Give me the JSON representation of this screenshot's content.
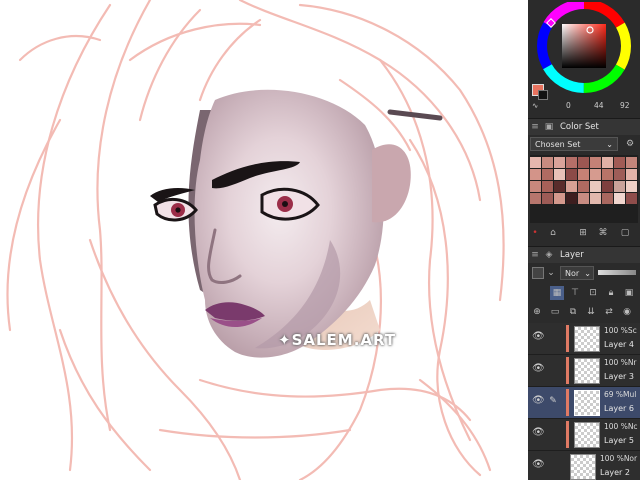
{
  "canvas": {
    "watermark": "✦SALEM.ART"
  },
  "color_wheel": {
    "hue_color": "#ff2a1a",
    "main_color": "#e8735f",
    "sub_color": "#111111",
    "values": [
      "0",
      "44",
      "92"
    ]
  },
  "color_set": {
    "title": "Color Set",
    "selected_set": "Chosen Set",
    "swatches": [
      "#e6b7ae",
      "#c88b80",
      "#d9a39a",
      "#b56f68",
      "#9c5752",
      "#c48176",
      "#e0b1a6",
      "#a15b55",
      "#c4857b",
      "#d39489",
      "#b06b62",
      "#e8c2b8",
      "#8c4a47",
      "#c78175",
      "#d69b8f",
      "#b87468",
      "#9e5d58",
      "#e3b3a9",
      "#c9887d",
      "#a76058",
      "#5a2c2b",
      "#d8a195",
      "#b06a61",
      "#e9c8be",
      "#7e3f3e",
      "#caa39a",
      "#f0d0c6",
      "#b7766d",
      "#9d5b56",
      "#d4998d",
      "#3d1e1f",
      "#c88c82",
      "#e2b8ad",
      "#a9675f",
      "#f1d6cf",
      "#8f4d4b"
    ]
  },
  "layer_panel": {
    "title": "Layer",
    "blend_mode": "Nor",
    "layers": [
      {
        "mode": "100 %Sc",
        "name": "Layer 4",
        "selected": false
      },
      {
        "mode": "100 %Nr",
        "name": "Layer 3",
        "selected": false
      },
      {
        "mode": "69 %Mul",
        "name": "Layer 6",
        "selected": true
      },
      {
        "mode": "100 %Nc",
        "name": "Layer 5",
        "selected": false
      },
      {
        "mode": "100 %Nor",
        "name": "Layer 2",
        "selected": false
      }
    ]
  }
}
